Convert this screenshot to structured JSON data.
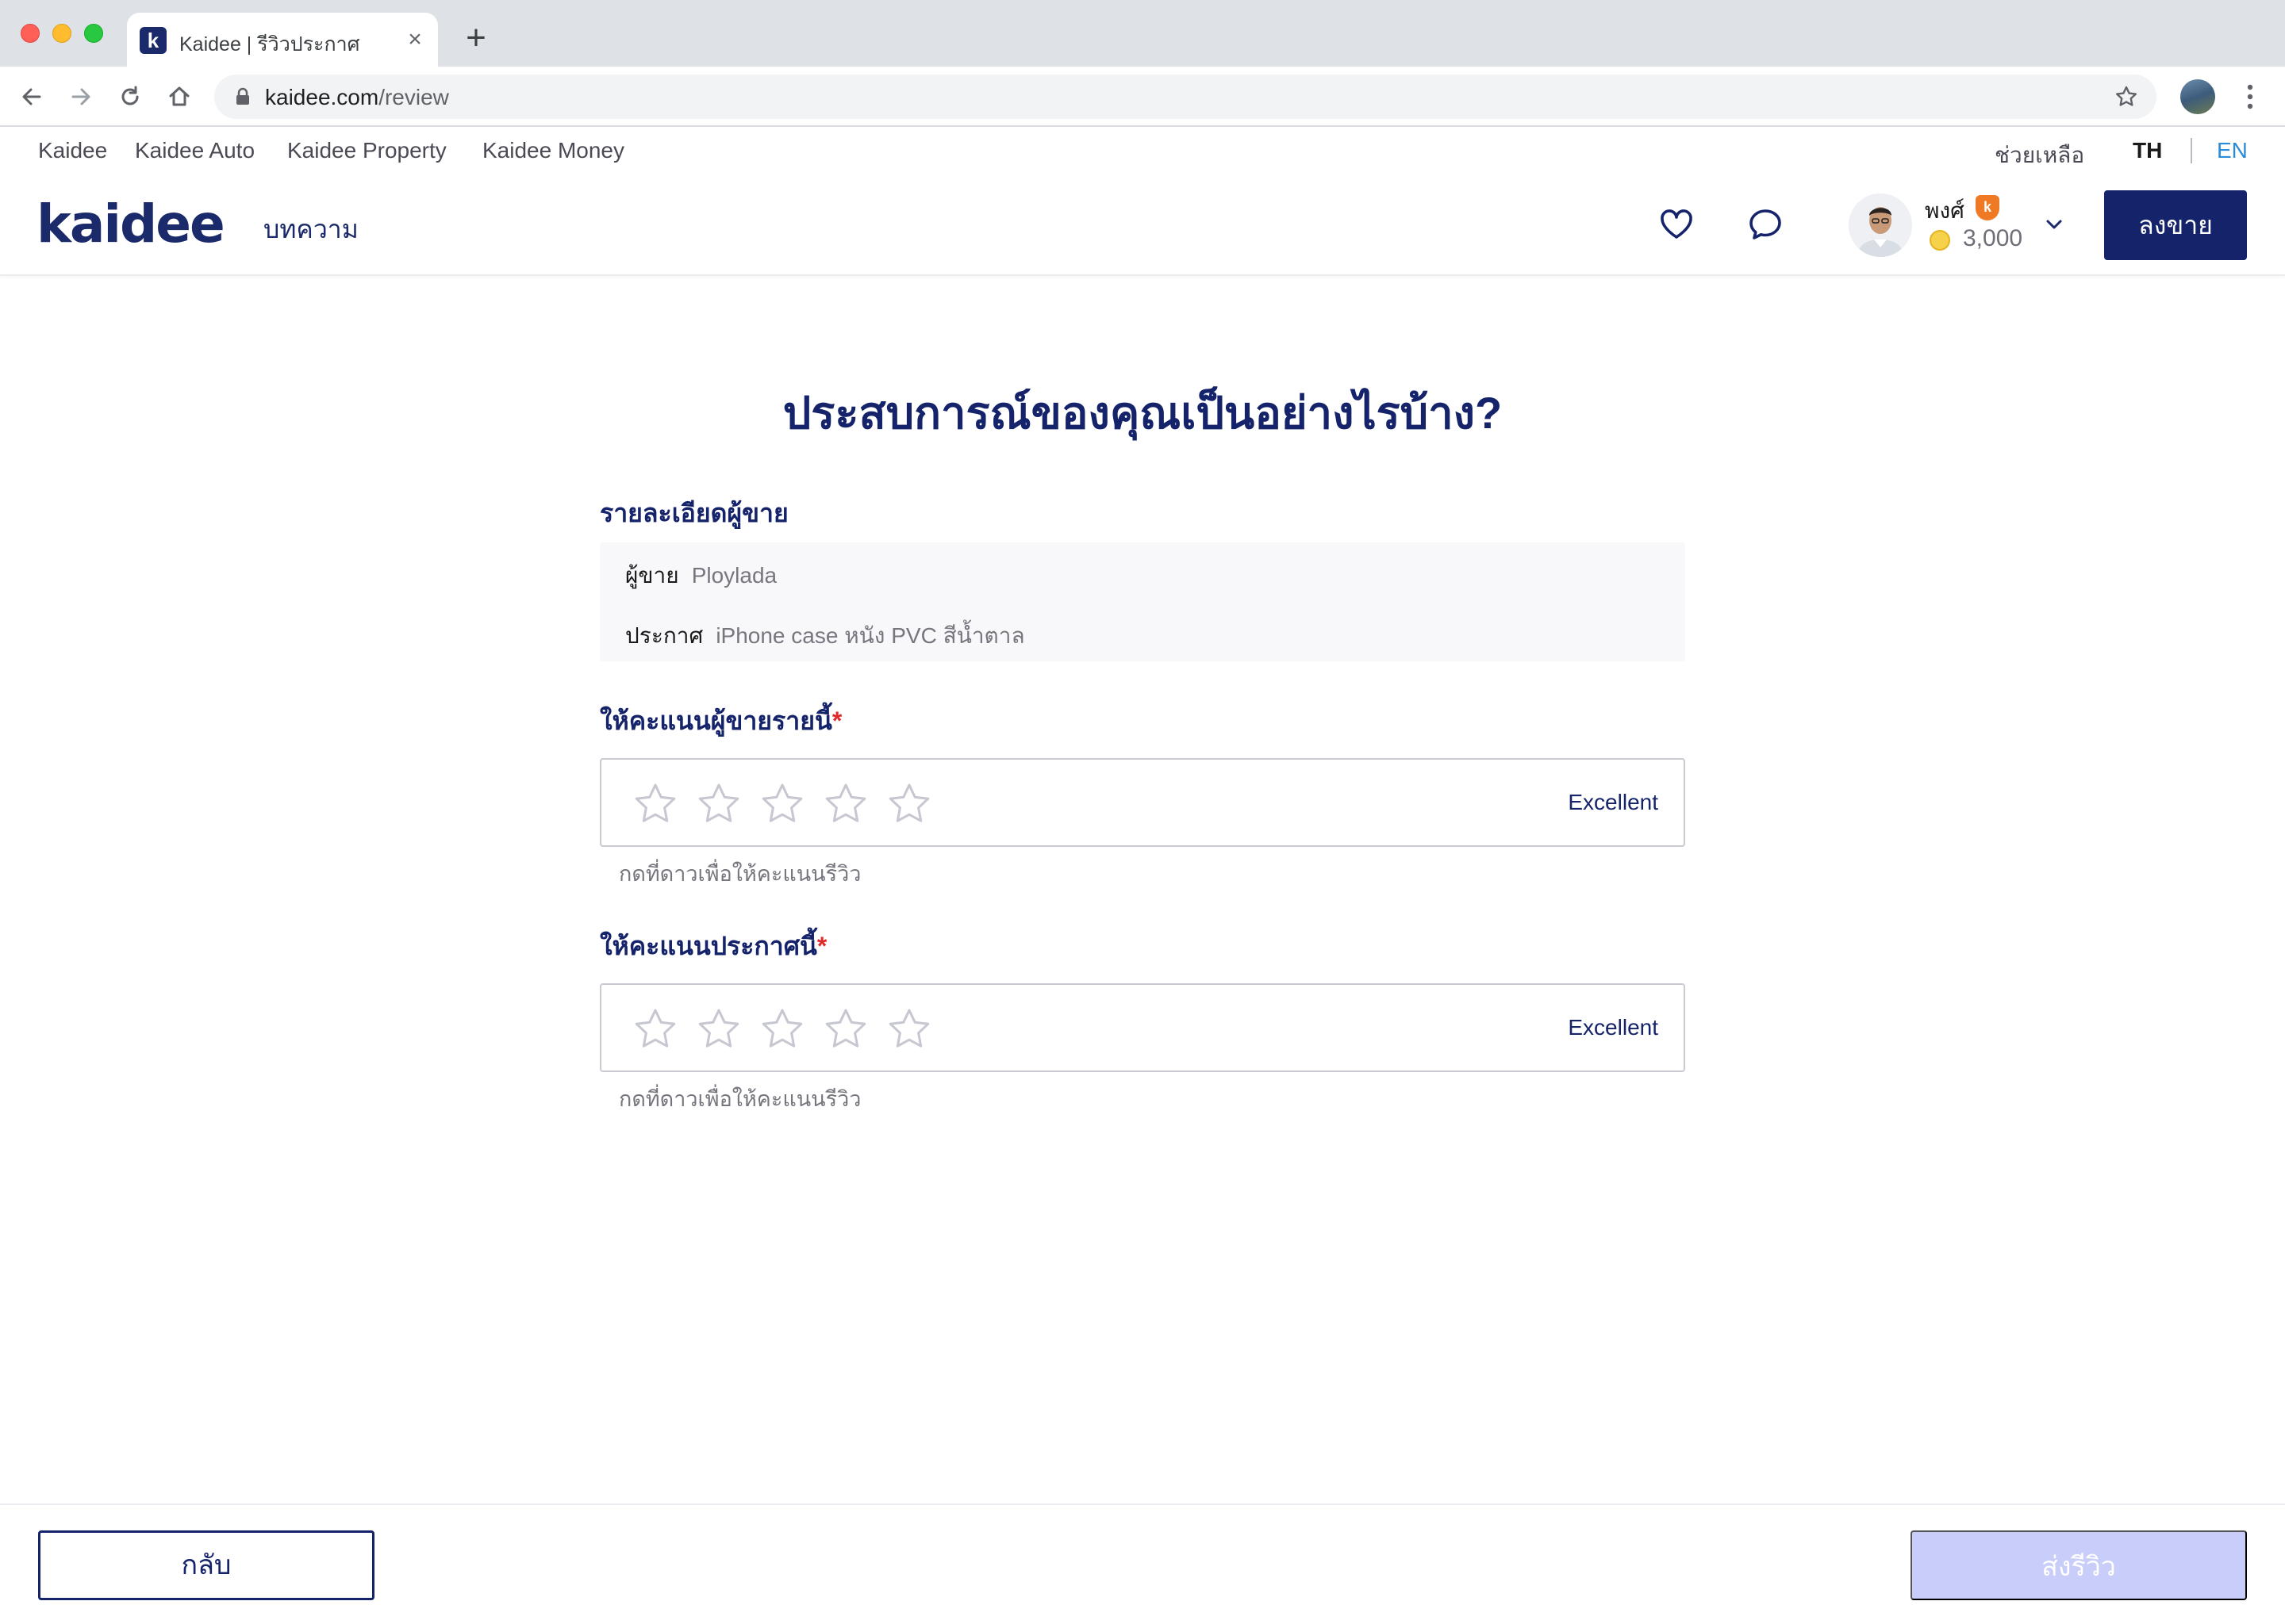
{
  "browser": {
    "tab_title": "Kaidee | รีวิวประกาศ",
    "tab_favicon": "k",
    "url_host": "kaidee.com",
    "url_path": "/review"
  },
  "topnav": {
    "links": [
      "Kaidee",
      "Kaidee Auto",
      "Kaidee Property",
      "Kaidee Money"
    ],
    "help": "ช่วยเหลือ",
    "lang_th": "TH",
    "lang_en": "EN"
  },
  "header": {
    "logo": "kaidee",
    "articles": "บทความ",
    "username": "พงศ์",
    "badge": "k",
    "coins": "3,000",
    "sell_label": "ลงขาย"
  },
  "main": {
    "title": "ประสบการณ์ของคุณเป็นอย่างไรบ้าง?",
    "seller_section": {
      "label": "รายละเอียดผู้ขาย",
      "seller_key": "ผู้ขาย",
      "seller_value": "Ploylada",
      "listing_key": "ประกาศ",
      "listing_value": "iPhone case หนัง PVC สีน้ำตาล"
    },
    "seller_rating": {
      "label": "ให้คะแนนผู้ขายรายนี้",
      "required_mark": "*",
      "rating": 0,
      "max": 5,
      "rating_text": "Excellent",
      "hint": "กดที่ดาวเพื่อให้คะแนนรีวิว"
    },
    "listing_rating": {
      "label": "ให้คะแนนประกาศนี้",
      "required_mark": "*",
      "rating": 0,
      "max": 5,
      "rating_text": "Excellent",
      "hint": "กดที่ดาวเพื่อให้คะแนนรีวิว"
    }
  },
  "footer": {
    "back_label": "กลับ",
    "submit_label": "ส่งรีวิว"
  },
  "colors": {
    "brand_navy": "#15236b",
    "link_blue": "#2a8bd8",
    "submit_disabled": "#c9cdfa",
    "required_red": "#e02a2a",
    "star_outline": "#c6c7d1"
  }
}
